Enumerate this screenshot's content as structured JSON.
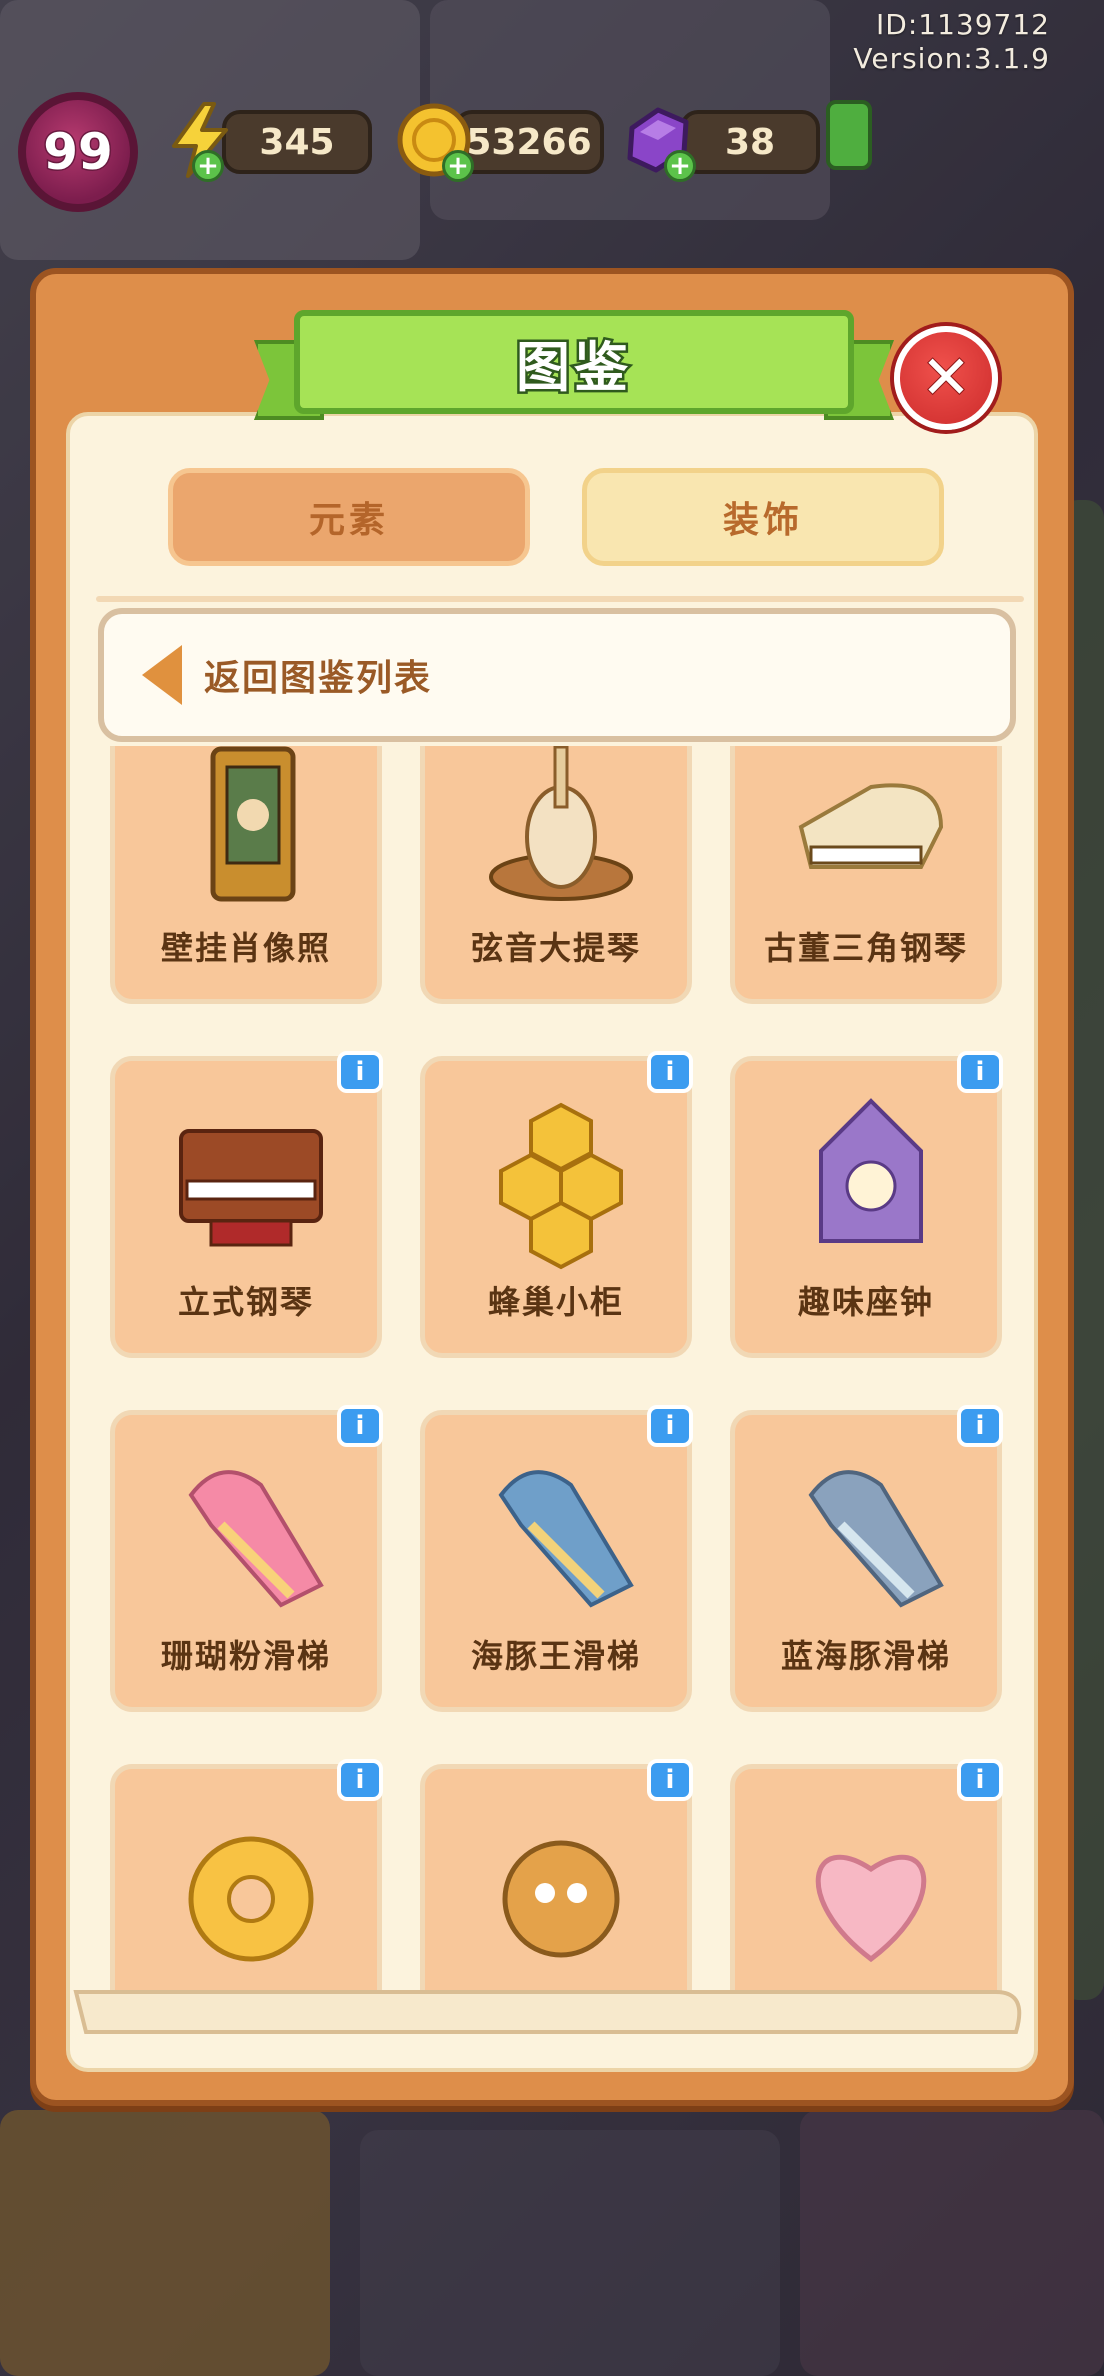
{
  "hud": {
    "id_text": "ID:1139712",
    "version_text": "Version:3.1.9",
    "level": "99",
    "energy": "345",
    "coins": "53266",
    "gems": "38"
  },
  "modal": {
    "title": "图鉴",
    "close_symbol": "✕",
    "tabs": [
      {
        "label": "元素",
        "selected": false
      },
      {
        "label": "装饰",
        "selected": true
      }
    ],
    "back_label": "返回图鉴列表",
    "info_symbol": "i",
    "items": [
      {
        "name": "壁挂肖像照",
        "icon": "portrait-frame-icon"
      },
      {
        "name": "弦音大提琴",
        "icon": "cello-icon"
      },
      {
        "name": "古董三角钢琴",
        "icon": "grand-piano-icon"
      },
      {
        "name": "立式钢琴",
        "icon": "upright-piano-icon"
      },
      {
        "name": "蜂巢小柜",
        "icon": "honeycomb-cabinet-icon"
      },
      {
        "name": "趣味座钟",
        "icon": "cuckoo-clock-icon"
      },
      {
        "name": "珊瑚粉滑梯",
        "icon": "pink-dolphin-slide-icon"
      },
      {
        "name": "海豚王滑梯",
        "icon": "dolphin-king-slide-icon"
      },
      {
        "name": "蓝海豚滑梯",
        "icon": "blue-dolphin-slide-icon"
      },
      {
        "name": "",
        "icon": "star-donut-icon"
      },
      {
        "name": "",
        "icon": "pufferfish-icon"
      },
      {
        "name": "",
        "icon": "heart-arch-icon"
      }
    ]
  },
  "colors": {
    "modal_frame": "#de8e4a",
    "modal_inner": "#fcf3dd",
    "ribbon_green": "#a6e356",
    "close_red": "#e23c3a",
    "cell_bg": "#f8c79a",
    "info_blue": "#3b9cf0"
  }
}
